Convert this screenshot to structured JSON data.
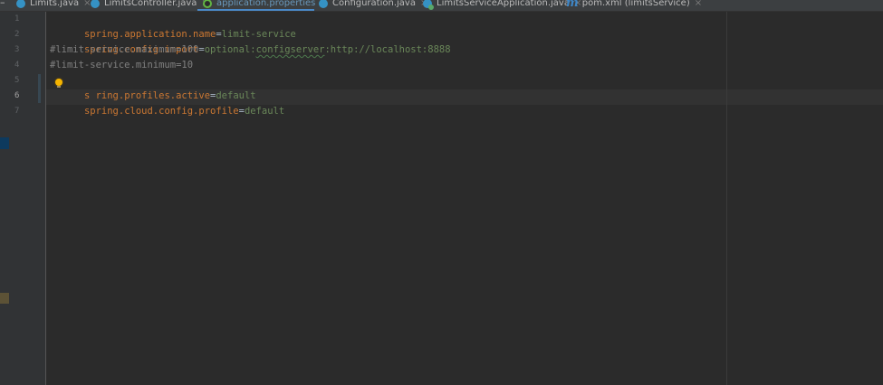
{
  "tabs": [
    {
      "label": "Limits.java",
      "icon": "java-class-icon",
      "active": false
    },
    {
      "label": "LimitsController.java",
      "icon": "java-class-icon",
      "active": false
    },
    {
      "label": "application.properties",
      "icon": "properties-file-icon",
      "active": true
    },
    {
      "label": "Configuration.java",
      "icon": "java-class-icon",
      "active": false
    },
    {
      "label": "LimitsServiceApplication.java",
      "icon": "spring-boot-app-icon",
      "active": false
    },
    {
      "label": "pom.xml (limitsService)",
      "icon": "maven-icon",
      "active": false
    }
  ],
  "tab_close_glyph": "×",
  "tab_prefix_glyph": "–",
  "gutter": {
    "line_numbers": [
      "1",
      "2",
      "3",
      "4",
      "5",
      "6",
      "7"
    ],
    "current_line": "6"
  },
  "code": {
    "line1": {
      "key": "spring.application.name",
      "eq": "=",
      "value": "limit-service"
    },
    "line2": {
      "key": "spring.config.import",
      "eq": "=",
      "value_prefix": "optional:",
      "value_squiggle": "configserver",
      "value_suffix": ":http://localhost:8888"
    },
    "line3": {
      "text": "#limit-service.maximum=100"
    },
    "line4": {
      "text": "#limit-service.minimum=10"
    },
    "line5": {
      "key_start": "s",
      "key_hidden": "p",
      "key_rest": "ring.profiles.active",
      "eq": "=",
      "value": "default"
    },
    "line6": {
      "key": "spring.cloud.config.profile",
      "eq": "=",
      "value": "default"
    },
    "line7": {
      "text": ""
    }
  },
  "colors": {
    "editor_bg": "#2b2b2b",
    "key": "#cc7832",
    "value": "#6a8759",
    "comment": "#808080",
    "tab_underline": "#4a88c7",
    "bulb": "#f5b400"
  }
}
